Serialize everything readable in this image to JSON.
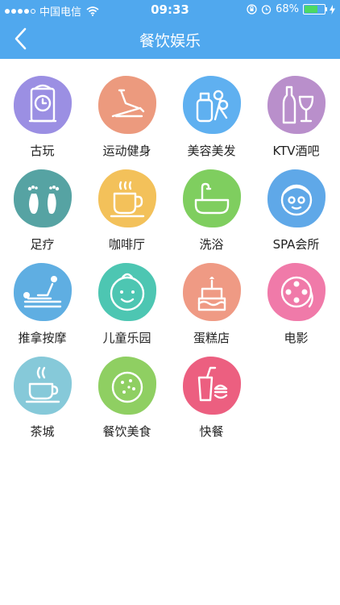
{
  "status": {
    "carrier": "中国电信",
    "time": "09:33",
    "battery": "68%",
    "battery_level": 0.68
  },
  "nav": {
    "title": "餐饮娱乐"
  },
  "categories": [
    {
      "label": "古玩",
      "icon": "clock-icon",
      "color": "#9b8fe3"
    },
    {
      "label": "运动健身",
      "icon": "treadmill-icon",
      "color": "#ec9a7e"
    },
    {
      "label": "美容美发",
      "icon": "scissors-bottle-icon",
      "color": "#5fb0f0"
    },
    {
      "label": "KTV酒吧",
      "icon": "wine-icon",
      "color": "#b98fcb"
    },
    {
      "label": "足疗",
      "icon": "footprints-icon",
      "color": "#56a3a3"
    },
    {
      "label": "咖啡厅",
      "icon": "coffee-cup-icon",
      "color": "#f3c15a"
    },
    {
      "label": "洗浴",
      "icon": "bathtub-icon",
      "color": "#7fce5f"
    },
    {
      "label": "SPA会所",
      "icon": "face-mask-icon",
      "color": "#5fa8e8"
    },
    {
      "label": "推拿按摩",
      "icon": "massage-icon",
      "color": "#5faee2"
    },
    {
      "label": "儿童乐园",
      "icon": "baby-face-icon",
      "color": "#4dc6b2"
    },
    {
      "label": "蛋糕店",
      "icon": "cake-icon",
      "color": "#ef9a84"
    },
    {
      "label": "电影",
      "icon": "film-reel-icon",
      "color": "#f07aa9"
    },
    {
      "label": "茶城",
      "icon": "tea-cup-icon",
      "color": "#86c9d9"
    },
    {
      "label": "餐饮美食",
      "icon": "cookie-icon",
      "color": "#8fcf62"
    },
    {
      "label": "快餐",
      "icon": "fast-food-icon",
      "color": "#ec5f80"
    }
  ]
}
